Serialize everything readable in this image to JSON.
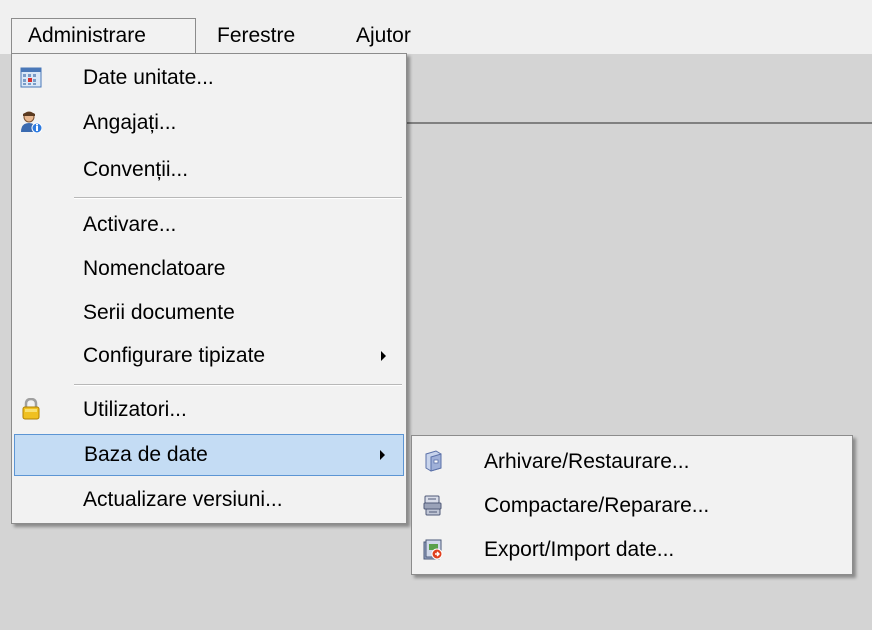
{
  "menubar": {
    "items": [
      {
        "label": "Administrare"
      },
      {
        "label": "Ferestre"
      },
      {
        "label": "Ajutor"
      }
    ]
  },
  "admin_menu": {
    "items": [
      {
        "label": "Date unitate...",
        "icon": "calendar-icon"
      },
      {
        "label": "Angajați...",
        "icon": "user-info-icon"
      },
      {
        "label": "Convenții..."
      },
      {
        "label": "Activare..."
      },
      {
        "label": "Nomenclatoare"
      },
      {
        "label": "Serii documente"
      },
      {
        "label": "Configurare tipizate",
        "submenu": true
      },
      {
        "label": "Utilizatori...",
        "icon": "lock-icon"
      },
      {
        "label": "Baza de date",
        "submenu": true,
        "highlighted": true
      },
      {
        "label": "Actualizare versiuni..."
      }
    ]
  },
  "submenu": {
    "items": [
      {
        "label": "Arhivare/Restaurare...",
        "icon": "archive-icon"
      },
      {
        "label": "Compactare/Reparare...",
        "icon": "compact-icon"
      },
      {
        "label": "Export/Import date...",
        "icon": "export-import-icon"
      }
    ]
  },
  "colors": {
    "background": "#d4d4d4",
    "menu_background": "#f2f2f2",
    "highlight": "#c4dcf4",
    "highlight_border": "#5c95d4"
  }
}
